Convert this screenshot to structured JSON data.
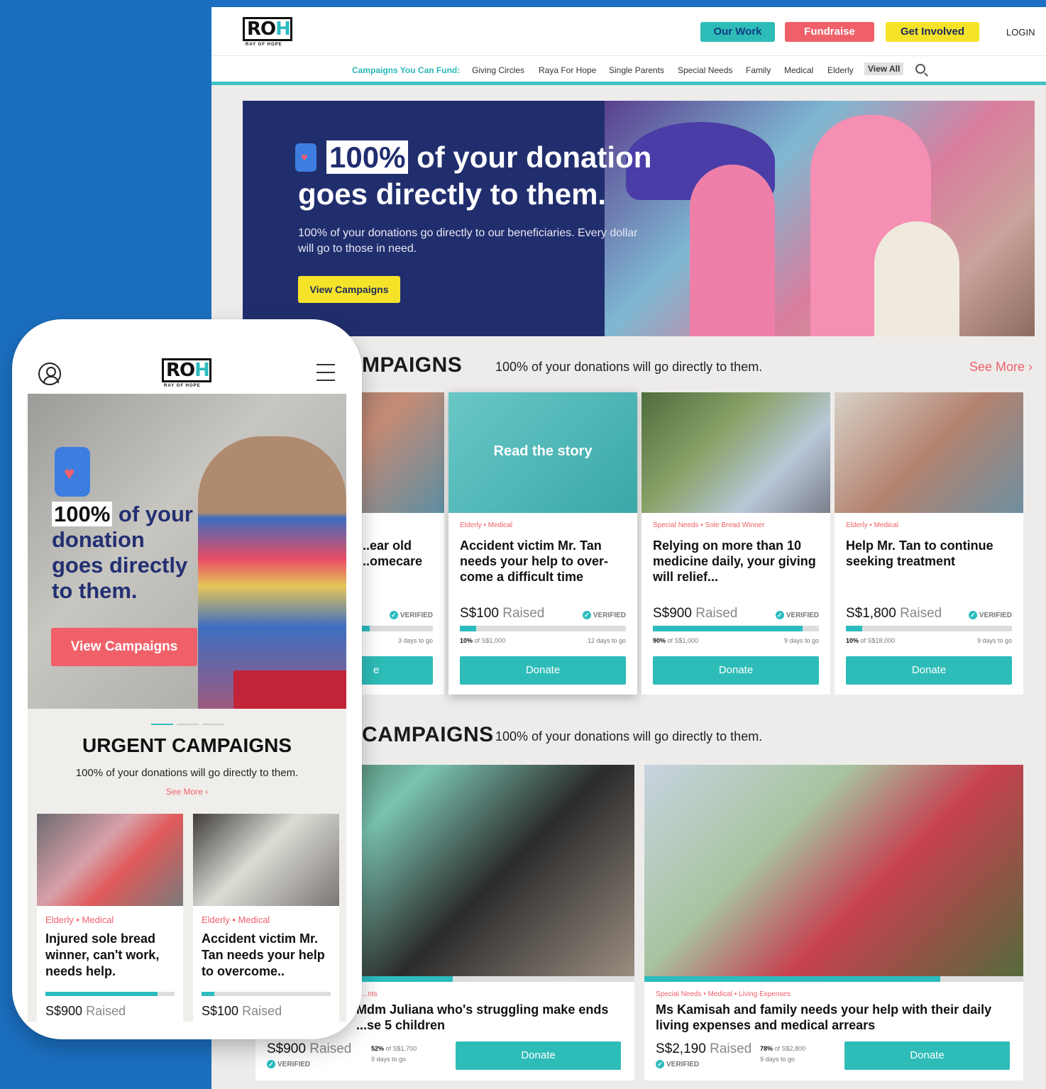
{
  "desktop": {
    "logo": {
      "mark": "RO",
      "mark_h": "H",
      "sub": "RAY OF HOPE"
    },
    "nav": {
      "our_work": "Our Work",
      "fundraise": "Fundraise",
      "get_involved": "Get Involved",
      "login": "LOGIN"
    },
    "categories": {
      "label": "Campaigns You Can Fund:",
      "items": [
        "Giving Circles",
        "Raya For Hope",
        "Single Parents",
        "Special Needs",
        "Family",
        "Medical",
        "Elderly"
      ],
      "view_all": "View All"
    },
    "hero": {
      "pct": "100%",
      "title_rest": "of your donation goes directly to them.",
      "body": "100% of your donations go directly to our beneficiaries. Every dollar will go to those in need.",
      "button": "View Campaigns"
    },
    "urgent": {
      "title": "MPAIGNS",
      "subtitle": "100% of your donations will go directly to them.",
      "see_more": "See More ›",
      "cards": [
        {
          "tag": "",
          "title": "...ear old ...omecare",
          "raised_amount": "",
          "raised_word": "",
          "verified": "VERIFIED",
          "progress": 0.62,
          "pct": "",
          "of": "",
          "days": "3 days to go",
          "donate": "e"
        },
        {
          "overlay": "Read the story",
          "tag": "Elderly • Medical",
          "title": "Accident victim Mr. Tan needs your help to over-come a difficult time",
          "raised_amount": "S$100",
          "raised_word": "Raised",
          "verified": "VERIFIED",
          "progress": 0.1,
          "pct": "10%",
          "of": "of S$1,000",
          "days": "12 days to go",
          "donate": "Donate"
        },
        {
          "tag": "Special Needs • Sole Bread Winner",
          "title": "Relying on more than 10 medicine daily, your giving will relief...",
          "raised_amount": "S$900",
          "raised_word": "Raised",
          "verified": "VERIFIED",
          "progress": 0.9,
          "pct": "90%",
          "of": "of S$1,000",
          "days": "9 days to go",
          "donate": "Donate"
        },
        {
          "tag": "Elderly • Medical",
          "title": "Help Mr. Tan to continue seeking treatment",
          "raised_amount": "S$1,800",
          "raised_word": "Raised",
          "verified": "VERIFIED",
          "progress": 0.1,
          "pct": "10%",
          "of": "of S$18,000",
          "days": "9 days to go",
          "donate": "Donate"
        }
      ]
    },
    "featured": {
      "title": "CAMPAIGNS",
      "subtitle": "100% of your donations will go directly to them.",
      "cards": [
        {
          "tag": "...nts",
          "title": "Mdm Juliana who's struggling make ends ...se 5 children",
          "raised_amount": "S$900",
          "raised_word": "Raised",
          "verified": "VERIFIED",
          "progress": 0.52,
          "pct": "52%",
          "of": "of S$1,700",
          "days": "9 days to go",
          "donate": "Donate"
        },
        {
          "tag": "Special Needs • Medical • Living Expenses",
          "title": "Ms Kamisah and family needs your help with their daily living expenses and medical arrears",
          "raised_amount": "S$2,190",
          "raised_word": "Raised",
          "verified": "VERIFIED",
          "progress": 0.78,
          "pct": "78%",
          "of": "of S$2,800",
          "days": "9 days to go",
          "donate": "Donate"
        }
      ]
    }
  },
  "mobile": {
    "logo": {
      "mark": "RO",
      "mark_h": "H",
      "sub": "RAY OF HOPE"
    },
    "hero": {
      "pct": "100%",
      "title_rest": "of your donation goes directly to them.",
      "button": "View Campaigns"
    },
    "section": {
      "title": "URGENT CAMPAIGNS",
      "subtitle": "100% of your donations will go directly to them.",
      "see_more": "See More ›"
    },
    "cards": [
      {
        "tag": "Elderly • Medical",
        "title": "Injured sole bread winner, can't work, needs help.",
        "raised_amount": "S$900",
        "raised_word": "Raised",
        "progress": 0.87
      },
      {
        "tag": "Elderly • Medical",
        "title": "Accident victim Mr. Tan needs your help to overcome..",
        "raised_amount": "S$100",
        "raised_word": "Raised",
        "progress": 0.1
      }
    ]
  },
  "icons": {
    "search": "search-icon",
    "user": "user-icon",
    "menu": "hamburger-menu-icon",
    "donation_jar": "donation-jar-icon"
  },
  "colors": {
    "brand_blue": "#1b6fc0",
    "teal": "#2ebcb8",
    "coral": "#f06069",
    "yellow": "#f5e32a",
    "navy": "#212e6e"
  }
}
